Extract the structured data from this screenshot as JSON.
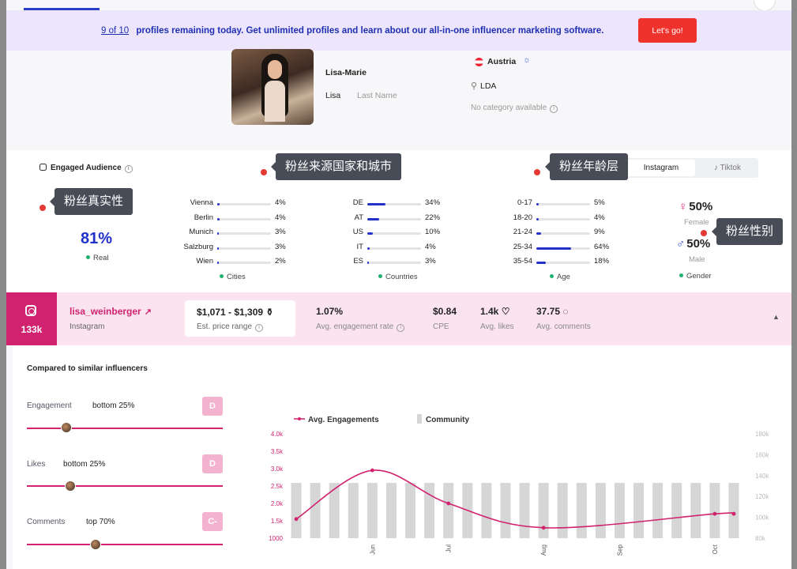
{
  "banner": {
    "count": "9 of 10",
    "text": "profiles remaining today. Get unlimited profiles and learn about our all-in-one influencer marketing software.",
    "cta": "Let's go!"
  },
  "profile": {
    "name": "Lisa-Marie",
    "first_name": "Lisa",
    "last_name_placeholder": "Last Name",
    "country": "Austria",
    "language": "LDA",
    "category": "No category available"
  },
  "audience": {
    "title": "Engaged Audience",
    "platforms": [
      "Instagram",
      "Tiktok"
    ],
    "real_value": "81%",
    "real_label": "Real",
    "cities": [
      {
        "label": "Vienna",
        "pct": "4%",
        "v": 4
      },
      {
        "label": "Berlin",
        "pct": "4%",
        "v": 4
      },
      {
        "label": "Munich",
        "pct": "3%",
        "v": 3
      },
      {
        "label": "Salzburg",
        "pct": "3%",
        "v": 3
      },
      {
        "label": "Wien",
        "pct": "2%",
        "v": 2
      }
    ],
    "cities_caption": "Cities",
    "countries": [
      {
        "label": "DE",
        "pct": "34%",
        "v": 34
      },
      {
        "label": "AT",
        "pct": "22%",
        "v": 22
      },
      {
        "label": "US",
        "pct": "10%",
        "v": 10
      },
      {
        "label": "IT",
        "pct": "4%",
        "v": 4
      },
      {
        "label": "ES",
        "pct": "3%",
        "v": 3
      }
    ],
    "countries_caption": "Countries",
    "ages": [
      {
        "label": "0-17",
        "pct": "5%",
        "v": 5
      },
      {
        "label": "18-20",
        "pct": "4%",
        "v": 4
      },
      {
        "label": "21-24",
        "pct": "9%",
        "v": 9
      },
      {
        "label": "25-34",
        "pct": "64%",
        "v": 64
      },
      {
        "label": "35-54",
        "pct": "18%",
        "v": 18
      }
    ],
    "age_caption": "Age",
    "female_pct": "50%",
    "female_label": "Female",
    "male_pct": "50%",
    "male_label": "Male",
    "gender_caption": "Gender"
  },
  "tooltips": {
    "authenticity": "粉丝真实性",
    "location": "粉丝来源国家和城市",
    "age": "粉丝年龄层",
    "gender": "粉丝性别"
  },
  "account": {
    "followers": "133k",
    "username": "lisa_weinberger",
    "platform": "Instagram",
    "price_range": "$1,071 - $1,309",
    "price_label": "Est. price range",
    "engagement_rate": "1.07%",
    "engagement_label": "Avg. engagement rate",
    "cpe": "$0.84",
    "cpe_label": "CPE",
    "likes": "1.4k",
    "likes_label": "Avg. likes",
    "comments": "37.75",
    "comments_label": "Avg. comments"
  },
  "compare": {
    "title": "Compared to similar influencers",
    "metrics": [
      {
        "label": "Engagement",
        "value": "bottom 25%",
        "grade": "D",
        "position": 0.2
      },
      {
        "label": "Likes",
        "value": "bottom 25%",
        "grade": "D",
        "position": 0.22
      },
      {
        "label": "Comments",
        "value": "top 70%",
        "grade": "C-",
        "position": 0.35
      }
    ]
  },
  "chart_data": {
    "type": "line",
    "legend": [
      "Avg. Engagements",
      "Community"
    ],
    "y_left_ticks": [
      "1000",
      "1.5k",
      "2.0k",
      "2.5k",
      "3.0k",
      "3.5k",
      "4.0k"
    ],
    "y_right_ticks": [
      "80k",
      "100k",
      "120k",
      "140k",
      "160k",
      "180k"
    ],
    "ylim_left": [
      1000,
      4000
    ],
    "ylim_right": [
      80000,
      180000
    ],
    "x_ticks": [
      "Jun",
      "Jul",
      "Aug",
      "Sep",
      "Oct"
    ],
    "x_tick_index": [
      4,
      8,
      13,
      17,
      22
    ],
    "community_bars": [
      133000,
      133000,
      133000,
      133000,
      133000,
      133000,
      133000,
      133000,
      133000,
      133000,
      133000,
      133000,
      133000,
      133000,
      133000,
      133000,
      133000,
      133000,
      133000,
      133000,
      133000,
      133000,
      133000,
      133000
    ],
    "engagement_points": [
      {
        "i": 0,
        "v": 1550
      },
      {
        "i": 4,
        "v": 2950
      },
      {
        "i": 8,
        "v": 2000
      },
      {
        "i": 13,
        "v": 1300
      },
      {
        "i": 22,
        "v": 1700
      },
      {
        "i": 23,
        "v": 1700
      }
    ],
    "colors": {
      "line": "#d1226f",
      "bars": "#d6d6d6",
      "axis_text": "#d1226f"
    }
  }
}
